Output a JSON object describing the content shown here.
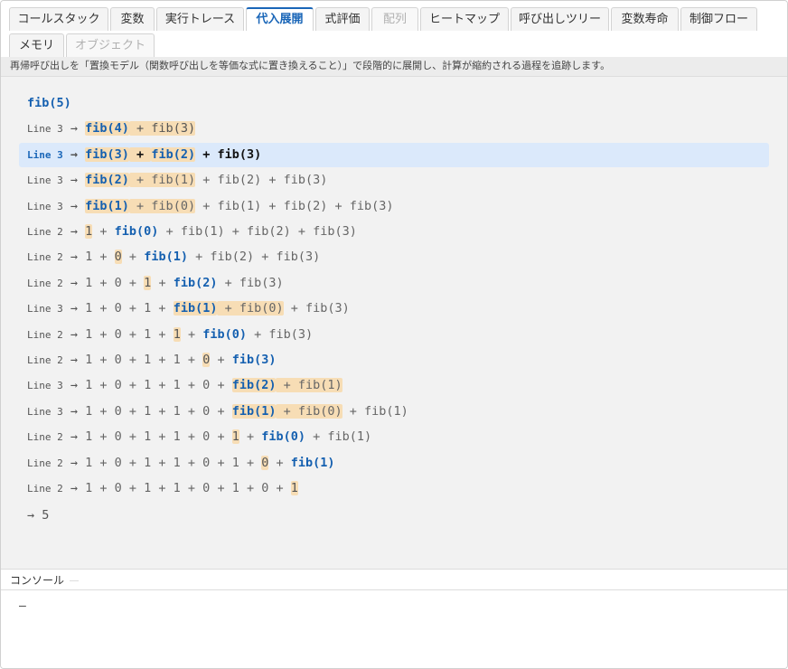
{
  "tabs": [
    {
      "label": "コールスタック",
      "state": "normal"
    },
    {
      "label": "変数",
      "state": "normal"
    },
    {
      "label": "実行トレース",
      "state": "normal"
    },
    {
      "label": "代入展開",
      "state": "active"
    },
    {
      "label": "式評価",
      "state": "normal"
    },
    {
      "label": "配列",
      "state": "disabled"
    },
    {
      "label": "ヒートマップ",
      "state": "normal"
    },
    {
      "label": "呼び出しツリー",
      "state": "normal"
    },
    {
      "label": "変数寿命",
      "state": "normal"
    },
    {
      "label": "制御フロー",
      "state": "normal"
    },
    {
      "label": "メモリ",
      "state": "normal"
    },
    {
      "label": "オブジェクト",
      "state": "disabled"
    }
  ],
  "description": "再帰呼び出しを「置換モデル（関数呼び出しを等価な式に置き換えること）」で段階的に展開し、計算が縮約される過程を追跡します。",
  "initial_expression": "fib(5)",
  "arrow": "→",
  "steps": [
    {
      "line": "Line 3",
      "current": false,
      "parts": [
        {
          "t": "fib(4)",
          "c": "fn hl"
        },
        {
          "t": " + fib(3)",
          "c": "hl"
        }
      ]
    },
    {
      "line": "Line 3",
      "current": true,
      "parts": [
        {
          "t": "fib(3)",
          "c": "fn hl"
        },
        {
          "t": " + ",
          "c": "hl"
        },
        {
          "t": "fib(2)",
          "c": "fn hl"
        },
        {
          "t": " + fib(3)",
          "c": ""
        }
      ]
    },
    {
      "line": "Line 3",
      "current": false,
      "parts": [
        {
          "t": "fib(2)",
          "c": "fn hl"
        },
        {
          "t": " + fib(1)",
          "c": "hl dim"
        },
        {
          "t": " + fib(2) + fib(3)",
          "c": "dim"
        }
      ]
    },
    {
      "line": "Line 3",
      "current": false,
      "parts": [
        {
          "t": "fib(1)",
          "c": "fn hl"
        },
        {
          "t": " + fib(0)",
          "c": "hl dim"
        },
        {
          "t": " + fib(1) + fib(2) + fib(3)",
          "c": "dim"
        }
      ]
    },
    {
      "line": "Line 2",
      "current": false,
      "parts": [
        {
          "t": "1",
          "c": "hl"
        },
        {
          "t": " + ",
          "c": "dim"
        },
        {
          "t": "fib(0)",
          "c": "fn"
        },
        {
          "t": " + fib(1) + fib(2) + fib(3)",
          "c": "dim"
        }
      ]
    },
    {
      "line": "Line 2",
      "current": false,
      "parts": [
        {
          "t": "1 + ",
          "c": "dim"
        },
        {
          "t": "0",
          "c": "hl"
        },
        {
          "t": " + ",
          "c": "dim"
        },
        {
          "t": "fib(1)",
          "c": "fn"
        },
        {
          "t": " + fib(2) + fib(3)",
          "c": "dim"
        }
      ]
    },
    {
      "line": "Line 2",
      "current": false,
      "parts": [
        {
          "t": "1 + 0 + ",
          "c": "dim"
        },
        {
          "t": "1",
          "c": "hl"
        },
        {
          "t": " + ",
          "c": "dim"
        },
        {
          "t": "fib(2)",
          "c": "fn"
        },
        {
          "t": " + fib(3)",
          "c": "dim"
        }
      ]
    },
    {
      "line": "Line 3",
      "current": false,
      "parts": [
        {
          "t": "1 + 0 + 1 + ",
          "c": "dim"
        },
        {
          "t": "fib(1)",
          "c": "fn hl"
        },
        {
          "t": " + fib(0)",
          "c": "hl dim"
        },
        {
          "t": " + fib(3)",
          "c": "dim"
        }
      ]
    },
    {
      "line": "Line 2",
      "current": false,
      "parts": [
        {
          "t": "1 + 0 + 1 + ",
          "c": "dim"
        },
        {
          "t": "1",
          "c": "hl"
        },
        {
          "t": " + ",
          "c": "dim"
        },
        {
          "t": "fib(0)",
          "c": "fn"
        },
        {
          "t": " + fib(3)",
          "c": "dim"
        }
      ]
    },
    {
      "line": "Line 2",
      "current": false,
      "parts": [
        {
          "t": "1 + 0 + 1 + 1 + ",
          "c": "dim"
        },
        {
          "t": "0",
          "c": "hl"
        },
        {
          "t": " + ",
          "c": "dim"
        },
        {
          "t": "fib(3)",
          "c": "fn"
        }
      ]
    },
    {
      "line": "Line 3",
      "current": false,
      "parts": [
        {
          "t": "1 + 0 + 1 + 1 + 0 + ",
          "c": "dim"
        },
        {
          "t": "fib(2)",
          "c": "fn hl"
        },
        {
          "t": " + fib(1)",
          "c": "hl dim"
        }
      ]
    },
    {
      "line": "Line 3",
      "current": false,
      "parts": [
        {
          "t": "1 + 0 + 1 + 1 + 0 + ",
          "c": "dim"
        },
        {
          "t": "fib(1)",
          "c": "fn hl"
        },
        {
          "t": " + fib(0)",
          "c": "hl dim"
        },
        {
          "t": " + fib(1)",
          "c": "dim"
        }
      ]
    },
    {
      "line": "Line 2",
      "current": false,
      "parts": [
        {
          "t": "1 + 0 + 1 + 1 + 0 + ",
          "c": "dim"
        },
        {
          "t": "1",
          "c": "hl"
        },
        {
          "t": " + ",
          "c": "dim"
        },
        {
          "t": "fib(0)",
          "c": "fn"
        },
        {
          "t": " + fib(1)",
          "c": "dim"
        }
      ]
    },
    {
      "line": "Line 2",
      "current": false,
      "parts": [
        {
          "t": "1 + 0 + 1 + 1 + 0 + 1 + ",
          "c": "dim"
        },
        {
          "t": "0",
          "c": "hl"
        },
        {
          "t": " + ",
          "c": "dim"
        },
        {
          "t": "fib(1)",
          "c": "fn"
        }
      ]
    },
    {
      "line": "Line 2",
      "current": false,
      "parts": [
        {
          "t": "1 + 0 + 1 + 1 + 0 + 1 + 0 + ",
          "c": "dim"
        },
        {
          "t": "1",
          "c": "hl"
        }
      ]
    }
  ],
  "result": "→ 5",
  "console": {
    "title": "コンソール",
    "output": "—"
  },
  "colors": {
    "accent": "#1a66b8",
    "highlight": "#f7ddb5",
    "current_row": "#dbe9fb"
  }
}
